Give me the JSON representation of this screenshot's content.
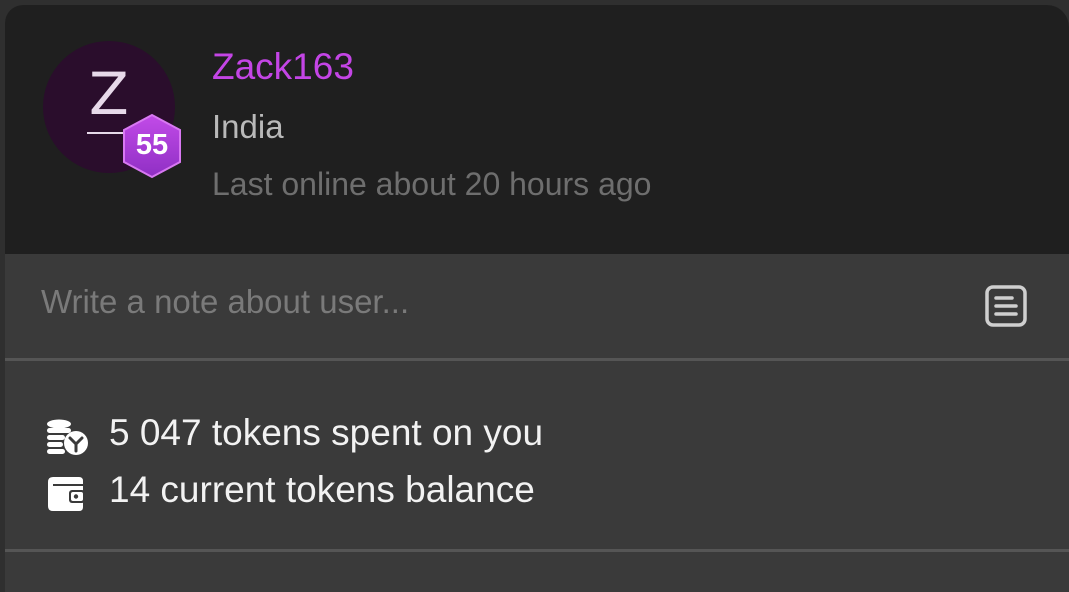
{
  "profile": {
    "avatar_letter": "Z",
    "level": "55",
    "username": "Zack163",
    "country": "India",
    "last_online": "Last online about 20 hours ago"
  },
  "note": {
    "placeholder": "Write a note about user...",
    "value": ""
  },
  "stats": {
    "spent": "5 047 tokens spent on you",
    "balance": "14 current tokens balance"
  },
  "icons": {
    "note": "note-icon",
    "spent": "coins-spent-icon",
    "balance": "wallet-icon"
  },
  "colors": {
    "username": "#c445e6",
    "level_badge": "#a93ad6",
    "header_bg": "#1f1f1f",
    "body_bg": "#3a3a3a"
  }
}
